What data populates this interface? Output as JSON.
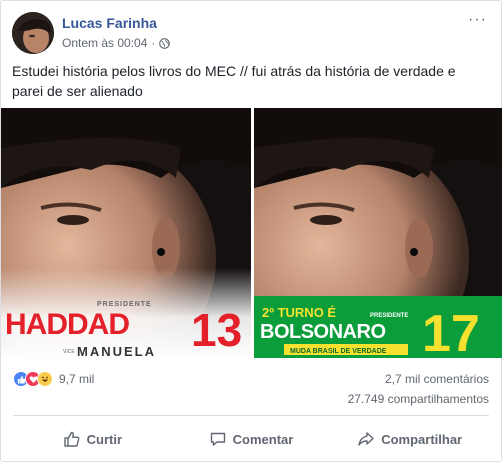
{
  "post": {
    "author": "Lucas Farinha",
    "timestamp": "Ontem às 00:04",
    "privacy_icon": "globe-icon",
    "body": "Estudei história pelos livros do MEC // fui atrás da história de verdade e parei de ser alienado"
  },
  "photos": {
    "left": {
      "label_small": "PRESIDENTE",
      "name": "HADDAD",
      "number": "13",
      "vice_prefix": "VICE",
      "vice": "MANUELA"
    },
    "right": {
      "headline": "2º TURNO É",
      "label_small": "PRESIDENTE",
      "name": "BOLSONARO",
      "number": "17",
      "slogan": "MUDA BRASIL DE VERDADE"
    }
  },
  "stats": {
    "reactions_count": "9,7 mil",
    "comments": "2,7 mil comentários",
    "shares": "27.749 compartilhamentos"
  },
  "actions": {
    "like": "Curtir",
    "comment": "Comentar",
    "share": "Compartilhar"
  },
  "colors": {
    "name_link": "#365899",
    "meta_text": "#616770",
    "haddad_red": "#e4202a",
    "bolsonaro_green": "#0a9d3a",
    "bolsonaro_yellow": "#f6e22e"
  }
}
